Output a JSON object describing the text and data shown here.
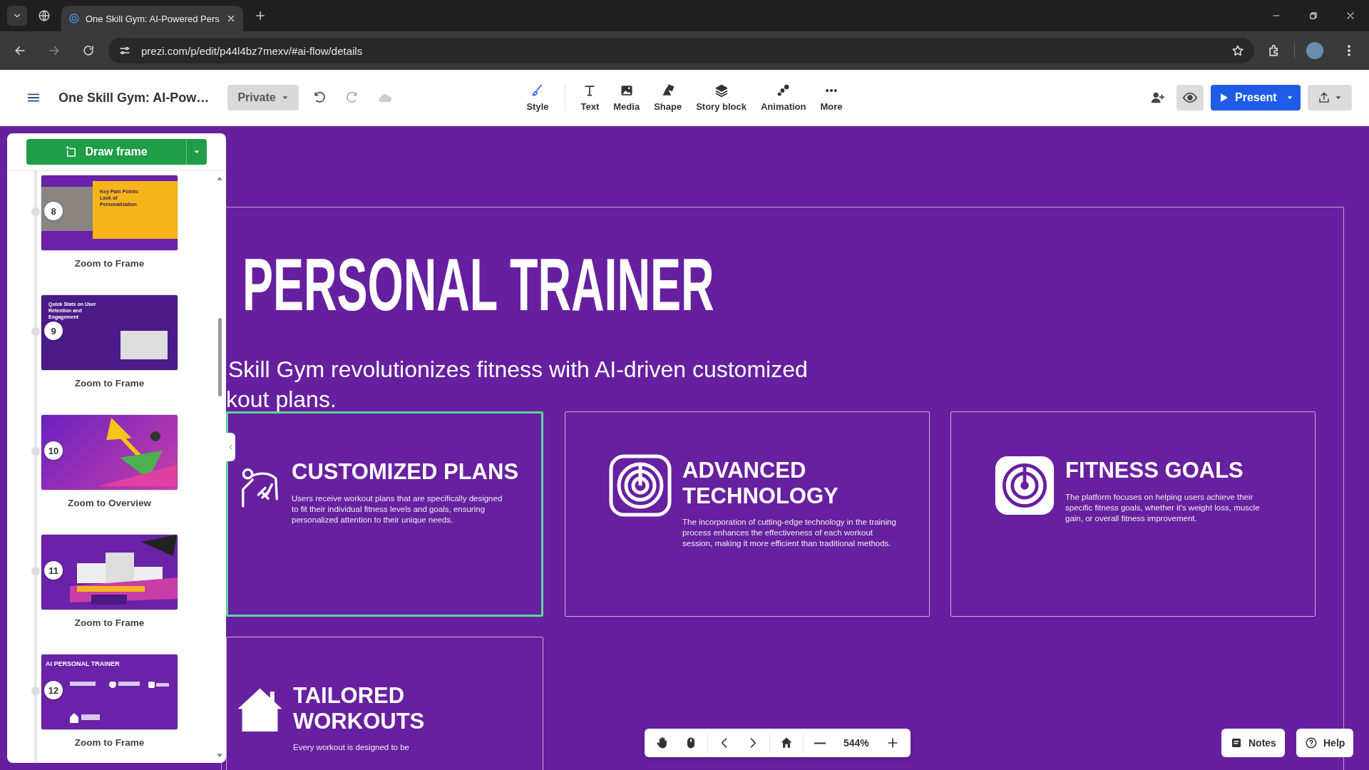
{
  "browser": {
    "tab_title": "One Skill Gym: AI-Powered Pers",
    "url": "prezi.com/p/edit/p44l4bz7mexv/#ai-flow/details"
  },
  "toolbar": {
    "title": "One Skill Gym: AI-Pow…",
    "privacy": "Private",
    "tools": [
      {
        "label": "Style",
        "kind": "style"
      },
      {
        "label": "Text",
        "kind": "text"
      },
      {
        "label": "Media",
        "kind": "media"
      },
      {
        "label": "Shape",
        "kind": "shape"
      },
      {
        "label": "Story block",
        "kind": "story-block"
      },
      {
        "label": "Animation",
        "kind": "animation"
      },
      {
        "label": "More",
        "kind": "more"
      }
    ],
    "present": "Present"
  },
  "sidebar": {
    "draw_frame": "Draw frame",
    "frames": [
      {
        "number": "8",
        "action": "Zoom to Frame",
        "kind": "photo-split",
        "title": "Key Pain Points: Lack of Personalization"
      },
      {
        "number": "9",
        "action": "Zoom to Frame",
        "kind": "stats",
        "title": "Quick Stats on User Retention and Engagement"
      },
      {
        "number": "10",
        "action": "Zoom to Overview",
        "kind": "overview"
      },
      {
        "number": "11",
        "action": "Zoom to Frame",
        "kind": "podium"
      },
      {
        "number": "12",
        "action": "Zoom to Frame",
        "kind": "cards",
        "title": "AI PERSONAL TRAINER"
      }
    ]
  },
  "slide": {
    "title": "PERSONAL TRAINER",
    "subtitle_lines": [
      "Skill Gym revolutionizes fitness with AI-driven customized",
      "kout plans."
    ],
    "cards": [
      {
        "title": "CUSTOMIZED PLANS",
        "text": "Users receive workout plans that are specifically designed to fit their individual fitness levels and goals, ensuring personalized attention to their unique needs.",
        "kind": "figure",
        "selected": true
      },
      {
        "title": "ADVANCED TECHNOLOGY",
        "text": "The incorporation of cutting-edge technology in the training process enhances the effectiveness of each workout session, making it more efficient than traditional methods.",
        "kind": "target-outline",
        "selected": false
      },
      {
        "title": "FITNESS GOALS",
        "text": "The platform focuses on helping users achieve their specific fitness goals, whether it's weight loss, muscle gain, or overall fitness improvement.",
        "kind": "target-filled",
        "selected": false
      },
      {
        "title": "TAILORED WORKOUTS",
        "text": "Every workout is designed to be",
        "kind": "house",
        "selected": false
      }
    ]
  },
  "bottom_bar": {
    "zoom": "544%"
  },
  "notes": "Notes",
  "help": "Help"
}
